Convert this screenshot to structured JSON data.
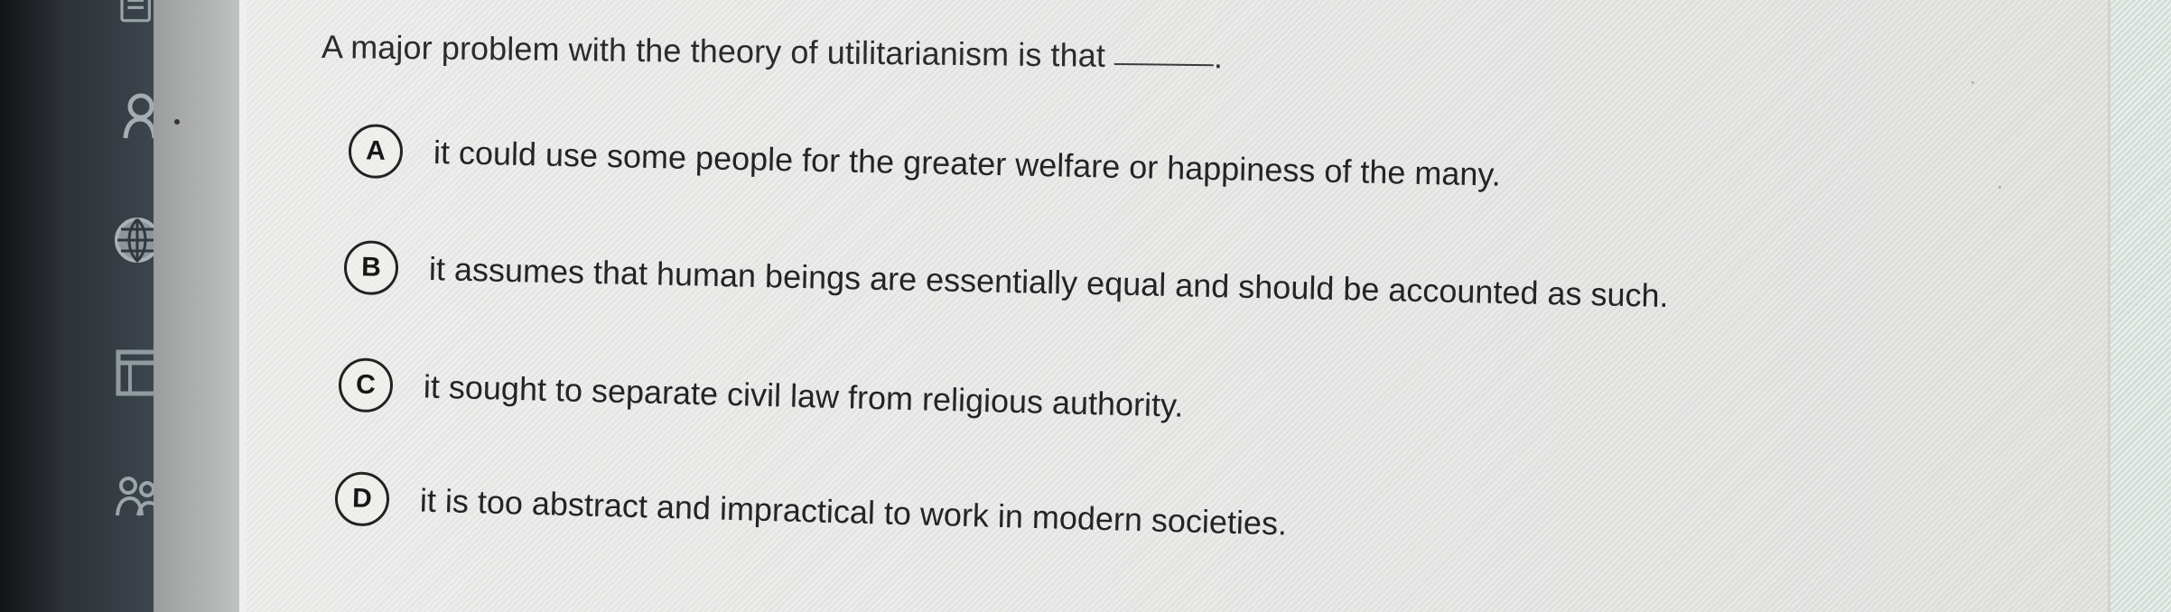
{
  "question": {
    "text": "A major problem with the theory of utilitarianism is that",
    "ending": "."
  },
  "options": [
    {
      "letter": "A",
      "text": "it could use some people for the greater welfare or happiness of the many."
    },
    {
      "letter": "B",
      "text": "it assumes that human beings are essentially equal and should be accounted as such."
    },
    {
      "letter": "C",
      "text": "it sought to separate civil law from religious authority."
    },
    {
      "letter": "D",
      "text": "it is too abstract and impractical to work in modern societies."
    }
  ],
  "sidebar": {
    "icons": [
      "book-icon",
      "user-icon",
      "globe-icon",
      "calendar-icon",
      "people-icon"
    ]
  },
  "colors": {
    "sidebar_dark": "#2d3338",
    "content_bg": "#e6e7e5",
    "text": "#252525",
    "accent_panel": "#dbe3de"
  }
}
